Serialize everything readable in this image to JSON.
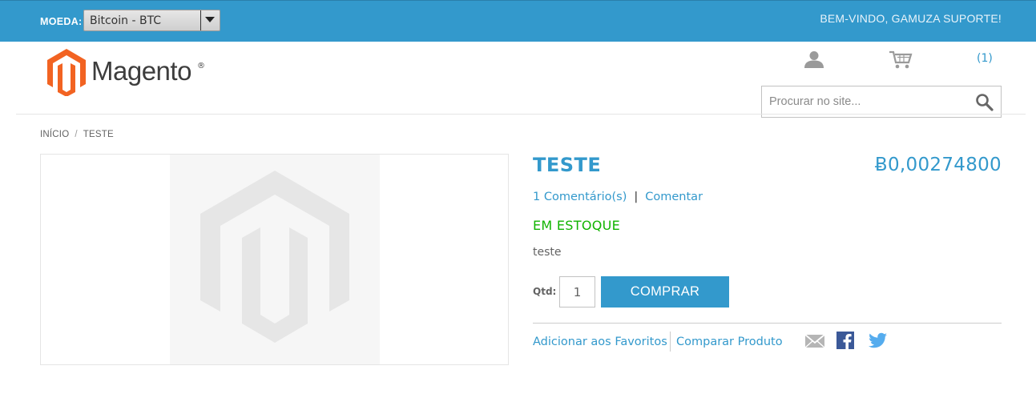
{
  "topbar": {
    "currency_label": "MOEDA:",
    "currency_selected": "Bitcoin - BTC",
    "welcome": "BEM-VINDO, GAMUZA SUPORTE!"
  },
  "header": {
    "logo_text": "Magento",
    "logo_reg": "®",
    "cart_count": "(1)",
    "search_placeholder": "Procurar no site..."
  },
  "breadcrumb": {
    "home": "INÍCIO",
    "separator": "/",
    "current": "TESTE"
  },
  "product": {
    "name": "TESTE",
    "price": "Ƀ0,00274800",
    "reviews_link": "1 Comentário(s)",
    "reviews_separator": "|",
    "add_review_link": "Comentar",
    "availability": "EM ESTOQUE",
    "short_description": "teste",
    "qty_label": "Qtd:",
    "qty_value": "1",
    "buy_label": "COMPRAR",
    "wishlist_link": "Adicionar aos Favoritos",
    "compare_link": "Comparar Produto"
  },
  "colors": {
    "brand": "#3399cc",
    "in_stock": "#11b400",
    "logo_orange": "#f26322"
  },
  "icons": {
    "account": "user-icon",
    "cart": "cart-icon",
    "search": "search-icon",
    "email": "email-icon",
    "facebook": "facebook-icon",
    "twitter": "twitter-icon"
  }
}
